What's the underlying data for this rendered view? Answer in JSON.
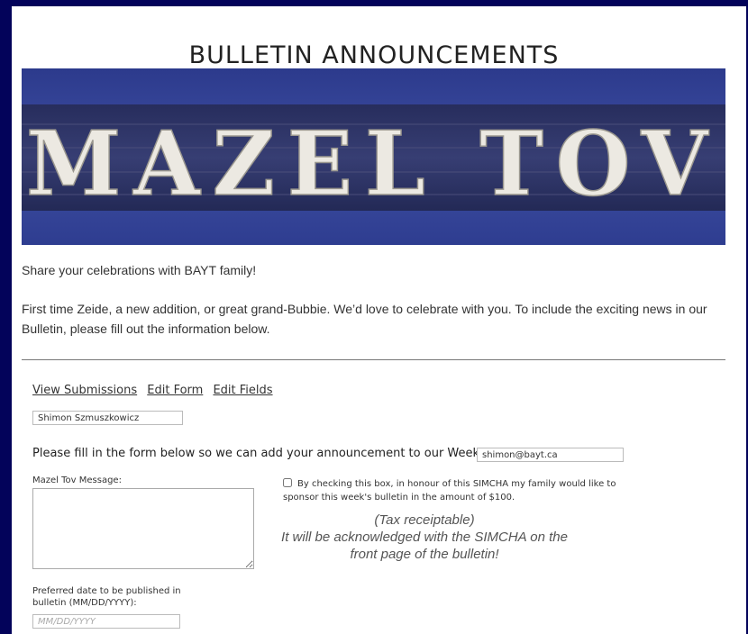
{
  "page": {
    "title": "BULLETIN ANNOUNCEMENTS"
  },
  "banner": {
    "text": "MAZEL TOV",
    "colors": {
      "background": "#3b4a9a",
      "letters": "#e9e6df"
    }
  },
  "intro": {
    "line1": "Share your celebrations with BAYT family!",
    "line2": "First time Zeide, a new addition, or great grand-Bubbie. We’d love to celebrate with you. To include the exciting news in our Bulletin, please fill out the information below."
  },
  "admin_links": {
    "view_submissions": "View Submissions",
    "edit_form": "Edit Form",
    "edit_fields": "Edit Fields"
  },
  "form": {
    "name_value": "Shimon Szmuszkowicz",
    "instructions": "Please fill in the form below so we can add your announcement to our Weekly Bulletin.",
    "email_value": "shimon@bayt.ca",
    "message_label": "Mazel Tov Message:",
    "sponsor_label": "By checking this box, in honour of this SIMCHA my family would like to sponsor this week's bulletin in the amount of $100.",
    "sponsor_checked": false,
    "note": "(Tax receiptable)\nIt will be acknowledged with the SIMCHA on the front page of the bulletin!",
    "date_label": "Preferred date to be published in bulletin (MM/DD/YYYY):",
    "date_placeholder": "MM/DD/YYYY"
  },
  "colors": {
    "frame": "#03035a"
  }
}
